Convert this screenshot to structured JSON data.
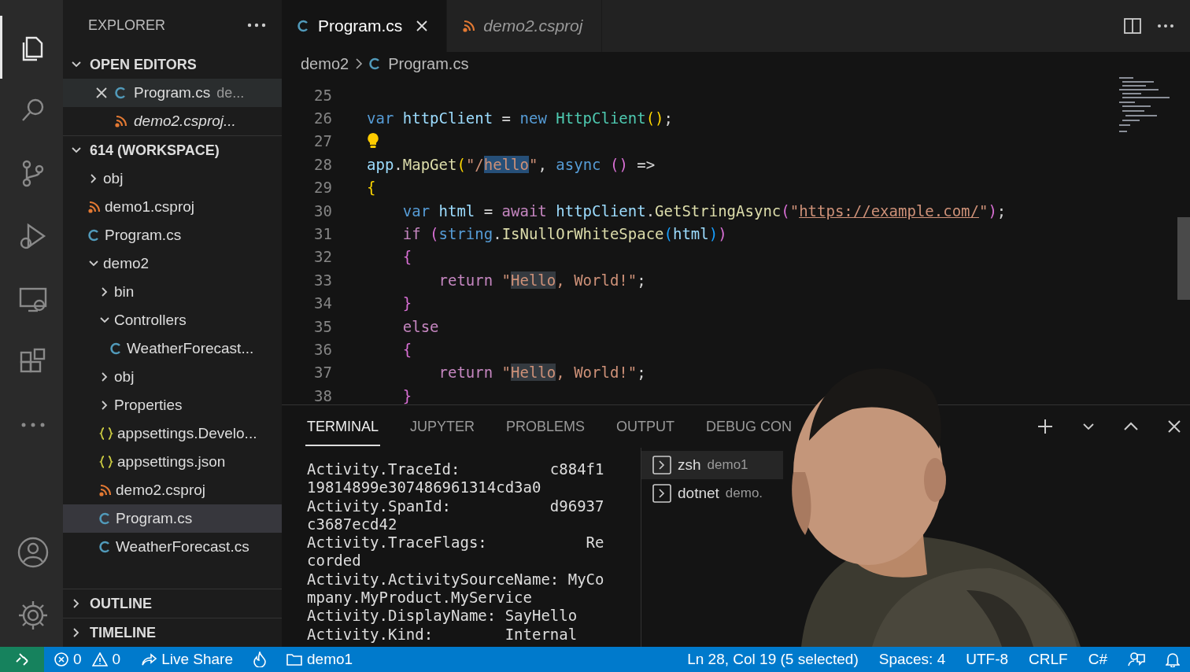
{
  "activity_bar": {
    "items": [
      {
        "kind": "files",
        "selected": true
      },
      {
        "kind": "search",
        "selected": false
      },
      {
        "kind": "source-control",
        "selected": false
      },
      {
        "kind": "run-debug",
        "selected": false
      },
      {
        "kind": "remote",
        "selected": false
      },
      {
        "kind": "extensions",
        "selected": false
      },
      {
        "kind": "more",
        "selected": false
      }
    ],
    "bottom": [
      {
        "kind": "account"
      },
      {
        "kind": "settings"
      }
    ]
  },
  "sidebar": {
    "title": "EXPLORER",
    "open_editors": {
      "title": "OPEN EDITORS",
      "expanded": true,
      "items": [
        {
          "name": "Program.cs",
          "detail": "de...",
          "kind": "csharp",
          "selected": true,
          "preview": false,
          "close": true
        },
        {
          "name": "demo2.csproj...",
          "kind": "rss",
          "selected": false,
          "preview": true,
          "close": false
        }
      ]
    },
    "workspace": {
      "title": "614 (WORKSPACE)",
      "expanded": true,
      "children": [
        {
          "name": "obj",
          "kind": "folder",
          "expanded": false,
          "selected": false
        },
        {
          "name": "demo1.csproj",
          "kind": "rss",
          "selected": false
        },
        {
          "name": "Program.cs",
          "kind": "csharp",
          "selected": false
        },
        {
          "name": "demo2",
          "kind": "folder",
          "expanded": true,
          "selected": false,
          "children": [
            {
              "name": "bin",
              "kind": "folder",
              "expanded": false,
              "selected": false
            },
            {
              "name": "Controllers",
              "kind": "folder",
              "expanded": true,
              "selected": false,
              "children": [
                {
                  "name": "WeatherForecast...",
                  "kind": "csharp",
                  "selected": false
                }
              ]
            },
            {
              "name": "obj",
              "kind": "folder",
              "expanded": false,
              "selected": false
            },
            {
              "name": "Properties",
              "kind": "folder",
              "expanded": false,
              "selected": false
            },
            {
              "name": "appsettings.Develo...",
              "kind": "json",
              "selected": false
            },
            {
              "name": "appsettings.json",
              "kind": "json",
              "selected": false
            },
            {
              "name": "demo2.csproj",
              "kind": "rss",
              "selected": false
            },
            {
              "name": "Program.cs",
              "kind": "csharp",
              "selected": true
            },
            {
              "name": "WeatherForecast.cs",
              "kind": "csharp",
              "selected": false
            }
          ]
        }
      ]
    },
    "sections": [
      {
        "title": "OUTLINE",
        "expanded": false
      },
      {
        "title": "TIMELINE",
        "expanded": false
      }
    ]
  },
  "editor": {
    "tabs": [
      {
        "label": "Program.cs",
        "kind": "csharp",
        "selected": true,
        "preview": false
      },
      {
        "label": "demo2.csproj",
        "kind": "rss",
        "selected": false,
        "preview": true
      }
    ],
    "breadcrumbs": [
      {
        "label": "demo2"
      },
      {
        "label": "Program.cs",
        "kind": "csharp"
      }
    ],
    "lines": [
      {
        "number": "25"
      },
      {
        "number": "26",
        "tokens": [
          {
            "t": "var",
            "kind": "kw"
          },
          {
            "t": " httpClient",
            "kind": "var"
          },
          {
            "t": " = ",
            "kind": "plain"
          },
          {
            "t": "new",
            "kind": "kw"
          },
          {
            "t": " HttpClient",
            "kind": "type"
          },
          {
            "t": "()",
            "kind": "p1"
          },
          {
            "t": ";",
            "kind": "plain"
          }
        ]
      },
      {
        "number": "27",
        "lightbulb": true
      },
      {
        "number": "28",
        "tokens": [
          {
            "t": "app",
            "kind": "var"
          },
          {
            "t": ".",
            "kind": "plain"
          },
          {
            "t": "MapGet",
            "kind": "fn"
          },
          {
            "t": "(",
            "kind": "p1"
          },
          {
            "t": "\"/",
            "kind": "str"
          },
          {
            "t": "hello",
            "kind": "sel"
          },
          {
            "t": "\"",
            "kind": "str"
          },
          {
            "t": ", ",
            "kind": "plain"
          },
          {
            "t": "async",
            "kind": "kw"
          },
          {
            "t": " ()",
            "kind": "p2"
          },
          {
            "t": " =>",
            "kind": "plain"
          }
        ]
      },
      {
        "number": "29",
        "tokens": [
          {
            "t": "{",
            "kind": "p1"
          }
        ]
      },
      {
        "number": "30",
        "tokens": [
          {
            "t": "    var",
            "kind": "kw"
          },
          {
            "t": " html",
            "kind": "var"
          },
          {
            "t": " = ",
            "kind": "plain"
          },
          {
            "t": "await",
            "kind": "ctrl"
          },
          {
            "t": " httpClient",
            "kind": "var"
          },
          {
            "t": ".",
            "kind": "plain"
          },
          {
            "t": "GetStringAsync",
            "kind": "fn"
          },
          {
            "t": "(",
            "kind": "p2"
          },
          {
            "t": "\"",
            "kind": "str"
          },
          {
            "t": "https://example.com/",
            "kind": "link"
          },
          {
            "t": "\"",
            "kind": "str"
          },
          {
            "t": ")",
            "kind": "p2"
          },
          {
            "t": ";",
            "kind": "plain"
          }
        ]
      },
      {
        "number": "31",
        "tokens": [
          {
            "t": "    if",
            "kind": "ctrl"
          },
          {
            "t": " (",
            "kind": "p2"
          },
          {
            "t": "string",
            "kind": "kw"
          },
          {
            "t": ".",
            "kind": "plain"
          },
          {
            "t": "IsNullOrWhiteSpace",
            "kind": "fn"
          },
          {
            "t": "(",
            "kind": "p3"
          },
          {
            "t": "html",
            "kind": "var"
          },
          {
            "t": ")",
            "kind": "p3"
          },
          {
            "t": ")",
            "kind": "p2"
          }
        ]
      },
      {
        "number": "32",
        "tokens": [
          {
            "t": "    {",
            "kind": "p2"
          }
        ]
      },
      {
        "number": "33",
        "tokens": [
          {
            "t": "        return",
            "kind": "ctrl"
          },
          {
            "t": " \"",
            "kind": "str"
          },
          {
            "t": "Hello",
            "kind": "match"
          },
          {
            "t": ", World!\"",
            "kind": "str"
          },
          {
            "t": ";",
            "kind": "plain"
          }
        ]
      },
      {
        "number": "34",
        "tokens": [
          {
            "t": "    }",
            "kind": "p2"
          }
        ]
      },
      {
        "number": "35",
        "tokens": [
          {
            "t": "    else",
            "kind": "ctrl"
          }
        ]
      },
      {
        "number": "36",
        "tokens": [
          {
            "t": "    {",
            "kind": "p2"
          }
        ]
      },
      {
        "number": "37",
        "tokens": [
          {
            "t": "        return",
            "kind": "ctrl"
          },
          {
            "t": " \"",
            "kind": "str"
          },
          {
            "t": "Hello",
            "kind": "match"
          },
          {
            "t": ", World!\"",
            "kind": "str"
          },
          {
            "t": ";",
            "kind": "plain"
          }
        ]
      },
      {
        "number": "38",
        "tokens": [
          {
            "t": "    }",
            "kind": "p2"
          }
        ]
      }
    ]
  },
  "panel": {
    "tabs": [
      {
        "label": "TERMINAL",
        "selected": true
      },
      {
        "label": "JUPYTER",
        "selected": false
      },
      {
        "label": "PROBLEMS",
        "selected": false
      },
      {
        "label": "OUTPUT",
        "selected": false
      },
      {
        "label": "DEBUG CON",
        "selected": false
      }
    ],
    "terminal_output": [
      "Activity.TraceId:          c884f1",
      "19814899e307486961314cd3a0",
      "Activity.SpanId:           d96937",
      "c3687ecd42",
      "Activity.TraceFlags:           Re",
      "corded",
      "Activity.ActivitySourceName: MyCo",
      "mpany.MyProduct.MyService",
      "Activity.DisplayName: SayHello",
      "Activity.Kind:        Internal"
    ],
    "terminals": [
      {
        "name": "zsh",
        "detail": "demo1",
        "selected": true
      },
      {
        "name": "dotnet",
        "detail": "demo.",
        "selected": false
      }
    ]
  },
  "status_bar": {
    "left": [
      {
        "kind": "remote"
      },
      {
        "kind": "errors",
        "text": "0"
      },
      {
        "kind": "warnings",
        "text": "0"
      },
      {
        "kind": "live-share",
        "text": "Live Share"
      },
      {
        "kind": "flame"
      },
      {
        "kind": "folder",
        "text": "demo1"
      }
    ],
    "right": [
      {
        "kind": "text",
        "text": "Ln 28, Col 19 (5 selected)"
      },
      {
        "kind": "text",
        "text": "Spaces: 4"
      },
      {
        "kind": "text",
        "text": "UTF-8"
      },
      {
        "kind": "text",
        "text": "CRLF"
      },
      {
        "kind": "text",
        "text": "C#"
      },
      {
        "kind": "feedback"
      },
      {
        "kind": "bell"
      }
    ]
  }
}
